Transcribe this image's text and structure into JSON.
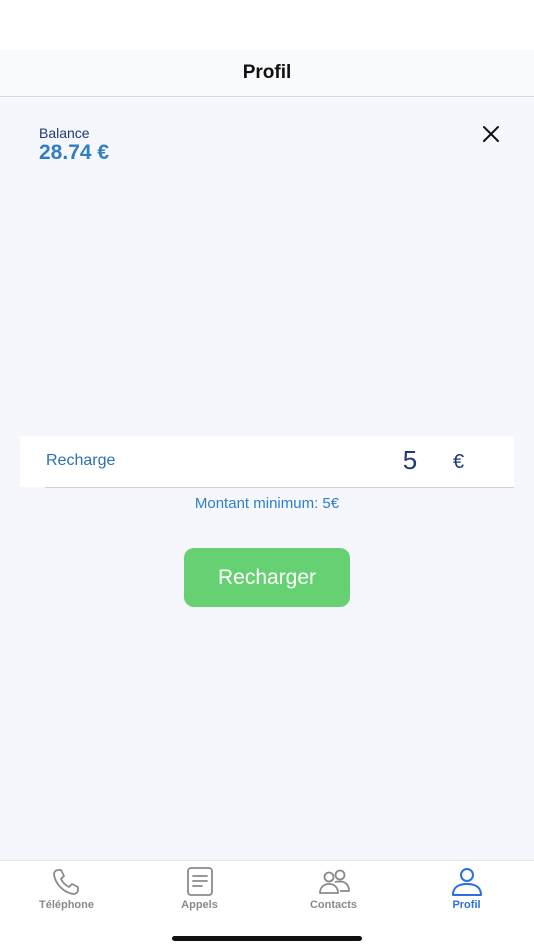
{
  "header": {
    "title": "Profil"
  },
  "balance": {
    "label": "Balance",
    "value": "28.74 €"
  },
  "recharge": {
    "label": "Recharge",
    "amount": "5",
    "currency": "€",
    "minimum_note": "Montant minimum: 5€",
    "button_label": "Recharger"
  },
  "tabs": [
    {
      "label": "Téléphone",
      "icon": "phone-icon",
      "active": false
    },
    {
      "label": "Appels",
      "icon": "call-log-icon",
      "active": false
    },
    {
      "label": "Contacts",
      "icon": "contacts-icon",
      "active": false
    },
    {
      "label": "Profil",
      "icon": "profile-icon",
      "active": true
    }
  ],
  "colors": {
    "accent": "#2b6fe0",
    "balance_value": "#2f7ec6",
    "button_green": "#65d172",
    "inactive_tab": "#8a8a8a"
  }
}
